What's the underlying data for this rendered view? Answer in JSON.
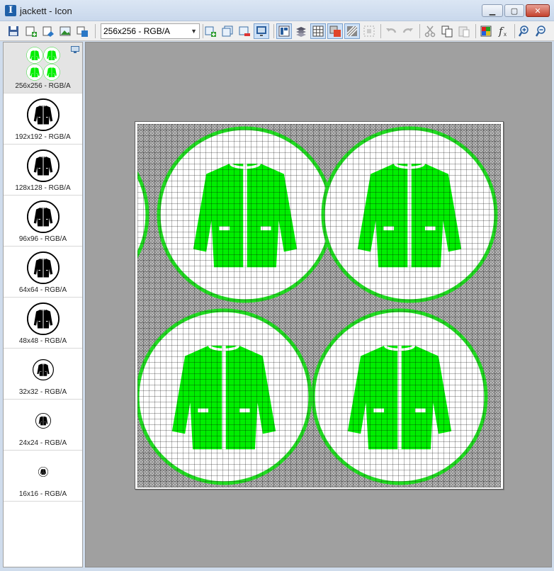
{
  "window": {
    "title": "jackett - Icon",
    "minimize": "▁",
    "maximize": "▢",
    "close": "✕"
  },
  "toolbar": {
    "format_select": "256x256 - RGB/A",
    "icons": [
      "save-icon",
      "new-image-icon",
      "export-icon",
      "import-image-icon",
      "resize-icon",
      "add-image-icon",
      "duplicate-image-icon",
      "delete-image-icon",
      "preview-icon",
      "layout-icon",
      "layers-icon",
      "grid-icon",
      "background-icon",
      "hatch-icon",
      "selection-icon",
      "undo-icon",
      "redo-icon",
      "cut-icon",
      "copy-icon",
      "paste-icon",
      "color-icon",
      "function-icon",
      "zoom-in-icon",
      "zoom-out-icon"
    ]
  },
  "images": [
    {
      "label": "256x256 - RGB/A",
      "size": 48,
      "selected": true
    },
    {
      "label": "192x192 - RGB/A",
      "size": 48
    },
    {
      "label": "128x128 - RGB/A",
      "size": 48
    },
    {
      "label": "96x96 - RGB/A",
      "size": 48
    },
    {
      "label": "64x64 - RGB/A",
      "size": 48
    },
    {
      "label": "48x48 - RGB/A",
      "size": 48
    },
    {
      "label": "32x32 - RGB/A",
      "size": 32
    },
    {
      "label": "24x24 - RGB/A",
      "size": 24
    },
    {
      "label": "16x16 - RGB/A",
      "size": 16
    }
  ],
  "colors": {
    "jacket_green": "#00ee00",
    "jacket_black": "#000000",
    "circle_white": "#ffffff",
    "selection": "#e4e4e4"
  }
}
